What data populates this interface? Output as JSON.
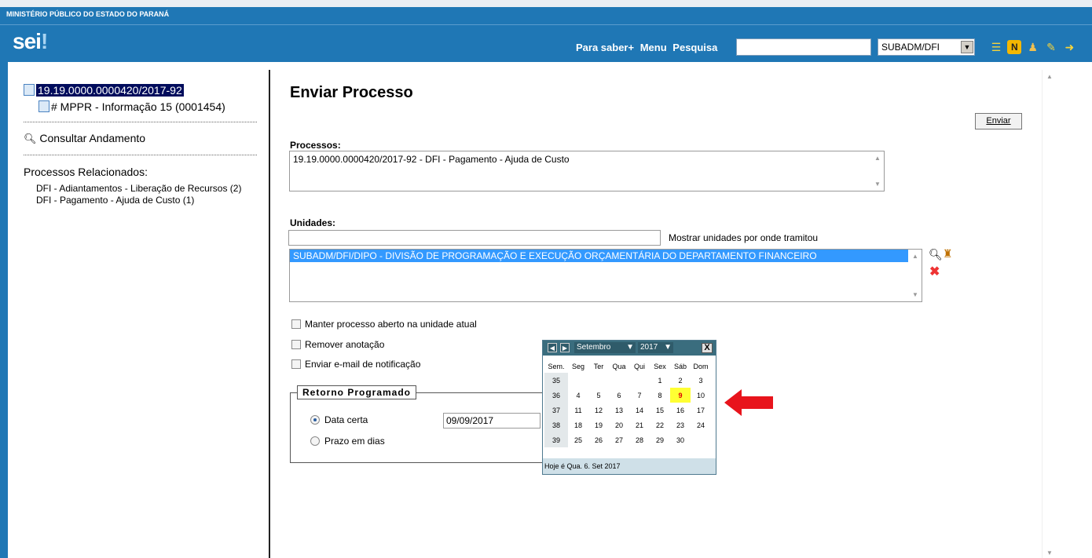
{
  "header": {
    "org": "MINISTÉRIO PÚBLICO DO ESTADO DO PARANÁ",
    "logo_main": "sei",
    "logo_dot": "!",
    "links": [
      "Para saber+",
      "Menu",
      "Pesquisa"
    ],
    "search_value": "",
    "unit_selected": "SUBADM/DFI"
  },
  "tree": {
    "process_number": "19.19.0000.0000420/2017-92",
    "document": "# MPPR - Informação 15 (0001454)",
    "consult": "Consultar Andamento",
    "related_heading": "Processos Relacionados:",
    "related": [
      "DFI - Adiantamentos - Liberação de Recursos (2)",
      "DFI - Pagamento - Ajuda de Custo (1)"
    ]
  },
  "form": {
    "title": "Enviar Processo",
    "send_button": "Enviar",
    "processes_label": "Processos:",
    "processes": [
      "19.19.0000.0000420/2017-92 - DFI - Pagamento - Ajuda de Custo"
    ],
    "units_label": "Unidades:",
    "units_input": "",
    "show_units_label": "Mostrar unidades por onde tramitou",
    "units": [
      "SUBADM/DFI/DIPO - DIVISÃO DE PROGRAMAÇÃO E EXECUÇÃO ORÇAMENTÁRIA DO DEPARTAMENTO FINANCEIRO"
    ],
    "checkboxes": [
      "Manter processo aberto na unidade atual",
      "Remover anotação",
      "Enviar e-mail de notificação"
    ],
    "return_legend": "Retorno Programado",
    "radio_date": "Data certa",
    "radio_days": "Prazo em dias",
    "date_value": "09/09/2017"
  },
  "calendar": {
    "month": "Setembro",
    "year": "2017",
    "close": "X",
    "headers": [
      "Sem.",
      "Seg",
      "Ter",
      "Qua",
      "Qui",
      "Sex",
      "Sáb",
      "Dom"
    ],
    "weeks": [
      [
        "35",
        "",
        "",
        "",
        "",
        "1",
        "2",
        "3"
      ],
      [
        "36",
        "4",
        "5",
        "6",
        "7",
        "8",
        "9",
        "10"
      ],
      [
        "37",
        "11",
        "12",
        "13",
        "14",
        "15",
        "16",
        "17"
      ],
      [
        "38",
        "18",
        "19",
        "20",
        "21",
        "22",
        "23",
        "24"
      ],
      [
        "39",
        "25",
        "26",
        "27",
        "28",
        "29",
        "30",
        ""
      ]
    ],
    "selected_day": "9",
    "footer": "Hoje é Qua. 6. Set 2017"
  }
}
